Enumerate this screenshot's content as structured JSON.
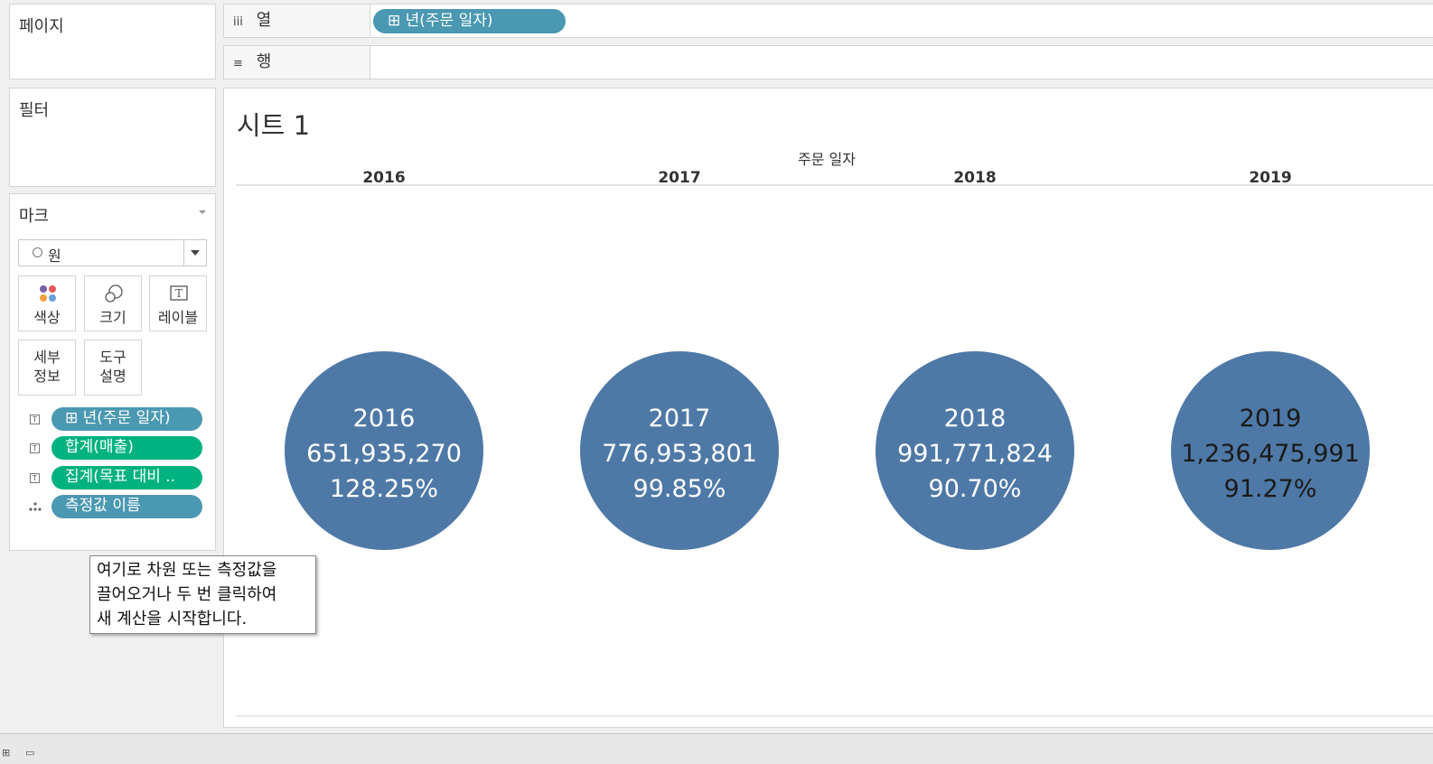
{
  "pages_card": {
    "title": "페이지"
  },
  "filters_card": {
    "title": "필터"
  },
  "marks_card": {
    "title": "마크",
    "mark_type": "원",
    "buttons": {
      "color": "색상",
      "size": "크기",
      "label": "레이블",
      "detail": "세부\n정보",
      "tooltip": "도구\n설명"
    },
    "pills": [
      {
        "text": "⊞ 년(주문 일자)",
        "type_icon": "T",
        "color": "#4a98b1"
      },
      {
        "text": "합계(매출)",
        "type_icon": "T",
        "color": "#00b27f"
      },
      {
        "text": "집계(목표 대비 ..",
        "type_icon": "T",
        "color": "#00b27f"
      },
      {
        "text": "측정값 이름",
        "type_icon": "detail-dots",
        "color": "#4a98b1"
      }
    ]
  },
  "shelves": {
    "columns": {
      "icon": "iii",
      "label": "열",
      "pill": "⊞ 년(주문 일자)"
    },
    "rows": {
      "icon": "≡",
      "label": "행"
    }
  },
  "view": {
    "sheet_title": "시트 1"
  },
  "tooltip": {
    "lines": [
      "여기로 차원 또는 측정값을",
      "끌어오거나 두 번 클릭하여",
      "새 계산을 시작합니다."
    ]
  },
  "chart_data": {
    "type": "scatter",
    "mark": "circle",
    "column_header": "주문 일자",
    "categories": [
      "2016",
      "2017",
      "2018",
      "2019"
    ],
    "labels": [
      [
        "2016",
        "651,935,270",
        "128.25%"
      ],
      [
        "2017",
        "776,953,801",
        "99.85%"
      ],
      [
        "2018",
        "991,771,824",
        "90.70%"
      ],
      [
        "2019",
        "1,236,475,991",
        "91.27%"
      ]
    ],
    "series": [
      {
        "values": [
          651935270,
          776953801,
          991771824,
          1236475991
        ]
      },
      {
        "values": [
          128.25,
          99.85,
          90.7,
          91.27
        ]
      }
    ],
    "mark_color": "#4e79a7",
    "label_colors": [
      "#ffffff",
      "#ffffff",
      "#ffffff",
      "#1a1a1a"
    ]
  }
}
